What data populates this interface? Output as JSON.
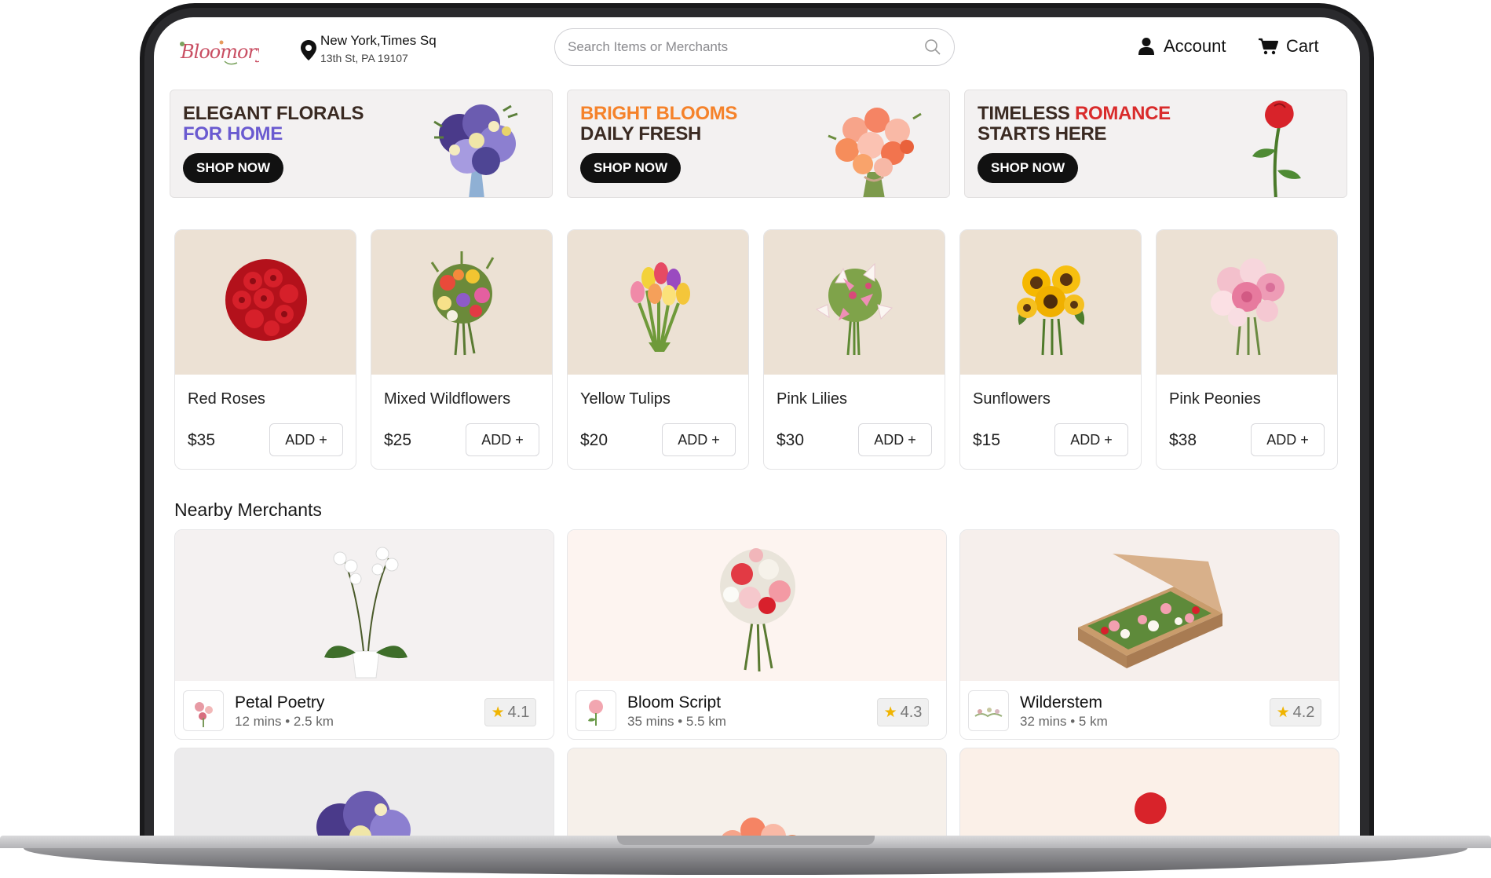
{
  "brand": {
    "logo_text": "Bloomory"
  },
  "location": {
    "line1": "New York,Times Sq",
    "line2": "13th St,  PA 19107"
  },
  "search": {
    "placeholder": "Search Items or Merchants"
  },
  "nav": {
    "account_label": "Account",
    "cart_label": "Cart"
  },
  "banners": [
    {
      "line1": "ELEGANT FLORALS",
      "line2": "FOR HOME",
      "line1_color": "#3a2a22",
      "line2_color": "#6a5ad0",
      "cta": "SHOP NOW"
    },
    {
      "line1": "BRIGHT BLOOMS",
      "line2": "DAILY FRESH",
      "line1_color": "#f5822a",
      "line2_color": "#3a2a22",
      "cta": "SHOP NOW"
    },
    {
      "line1a": "TIMELESS ",
      "line1b": "ROMANCE",
      "line2": "STARTS HERE",
      "line1a_color": "#3a2a22",
      "line1b_color": "#d92b2b",
      "line2_color": "#3a2a22",
      "cta": "SHOP NOW"
    }
  ],
  "products": [
    {
      "name": "Red Roses",
      "price": "$35",
      "add_label": "ADD  +"
    },
    {
      "name": "Mixed Wildflowers",
      "price": "$25",
      "add_label": "ADD  +"
    },
    {
      "name": "Yellow Tulips",
      "price": "$20",
      "add_label": "ADD  +"
    },
    {
      "name": "Pink Lilies",
      "price": "$30",
      "add_label": "ADD  +"
    },
    {
      "name": "Sunflowers",
      "price": "$15",
      "add_label": "ADD  +"
    },
    {
      "name": "Pink Peonies",
      "price": "$38",
      "add_label": "ADD  +"
    }
  ],
  "merchants_title": "Nearby Merchants",
  "merchants": [
    {
      "name": "Petal Poetry",
      "meta": "12 mins • 2.5 km",
      "rating": "4.1",
      "bg": "#f4f1f1"
    },
    {
      "name": "Bloom Script",
      "meta": "35 mins • 5.5 km",
      "rating": "4.3",
      "bg": "#fdf4f0"
    },
    {
      "name": "Wilderstem",
      "meta": "32 mins • 5 km",
      "rating": "4.2",
      "bg": "#f6efec"
    }
  ],
  "merchants_row2_bg": [
    "#ecebec",
    "#f6f0ea",
    "#fbf0e8"
  ],
  "colors": {
    "accent": "#111111",
    "card_image_bg": "#ece1d4",
    "star": "#f0b400"
  }
}
